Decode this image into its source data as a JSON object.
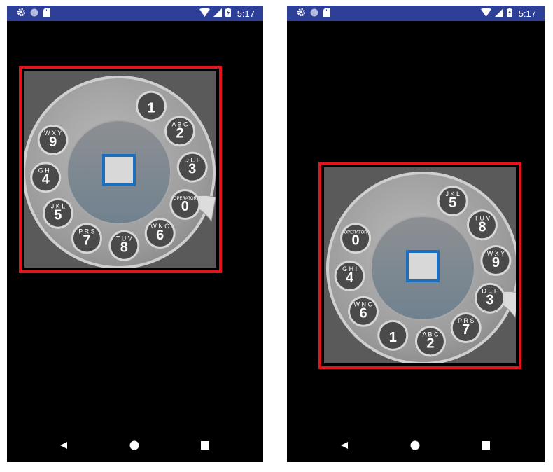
{
  "status_bar": {
    "time": "5:17",
    "icons": [
      "settings-icon",
      "circle-icon",
      "sd-card-icon",
      "wifi-icon",
      "signal-icon",
      "battery-icon"
    ]
  },
  "colors": {
    "status_bar": "#2e3f97",
    "frame": "#e3141b",
    "center_border": "#1b6fbe",
    "screen": "#000000",
    "dial_bg": "#5a5a5a"
  },
  "nav": {
    "icons": [
      "back-icon",
      "home-icon",
      "recents-icon"
    ]
  },
  "screens": [
    {
      "name": "left",
      "holes": [
        {
          "digit": "1",
          "letters": ""
        },
        {
          "digit": "2",
          "letters": "ABC"
        },
        {
          "digit": "3",
          "letters": "DEF"
        },
        {
          "digit": "0",
          "letters": "OPERATOR"
        },
        {
          "digit": "6",
          "letters": "WNO"
        },
        {
          "digit": "8",
          "letters": "TUV"
        },
        {
          "digit": "7",
          "letters": "PRS"
        },
        {
          "digit": "5",
          "letters": "JKL"
        },
        {
          "digit": "4",
          "letters": "GHI"
        },
        {
          "digit": "9",
          "letters": "WXY"
        }
      ]
    },
    {
      "name": "right",
      "holes": [
        {
          "digit": "5",
          "letters": "JKL"
        },
        {
          "digit": "8",
          "letters": "TUV"
        },
        {
          "digit": "9",
          "letters": "WXY"
        },
        {
          "digit": "3",
          "letters": "DEF"
        },
        {
          "digit": "7",
          "letters": "PRS"
        },
        {
          "digit": "2",
          "letters": "ABC"
        },
        {
          "digit": "1",
          "letters": ""
        },
        {
          "digit": "6",
          "letters": "WNO"
        },
        {
          "digit": "4",
          "letters": "GHI"
        },
        {
          "digit": "0",
          "letters": "OPERATOR"
        }
      ]
    }
  ]
}
